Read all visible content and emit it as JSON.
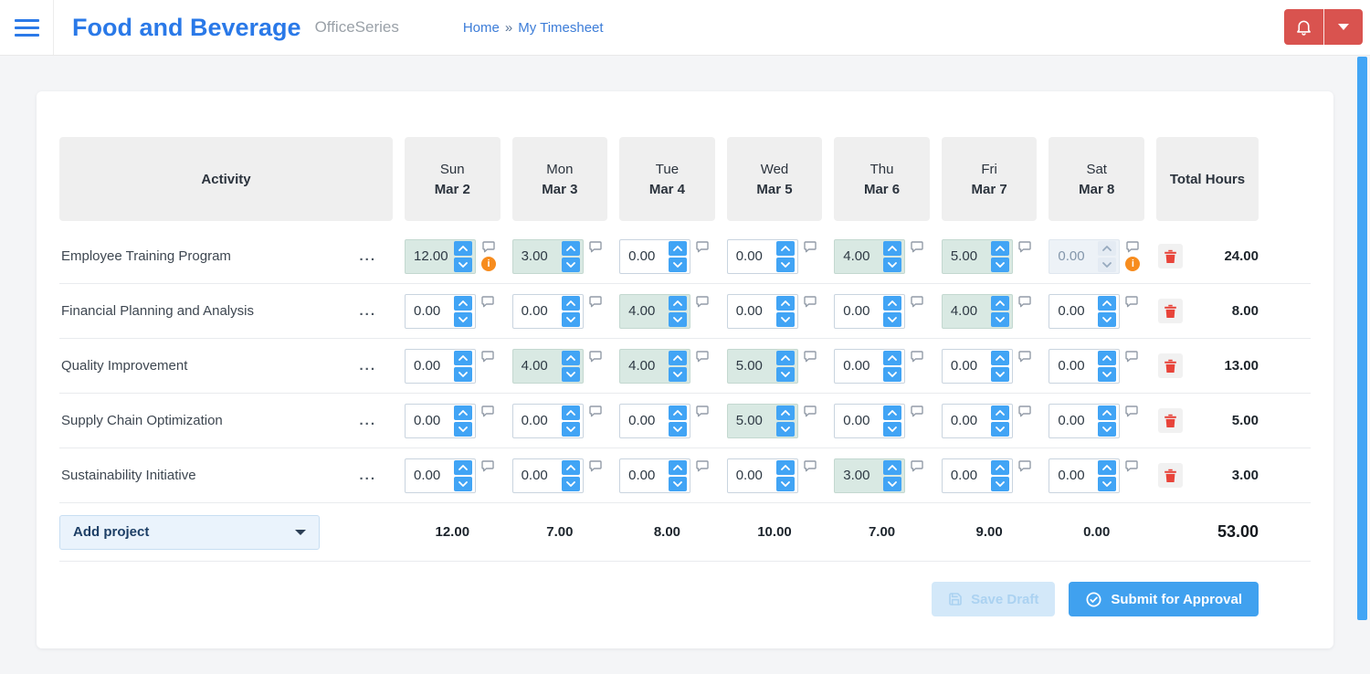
{
  "app": {
    "title": "Food and Beverage",
    "suite": "OfficeSeries",
    "breadcrumb": {
      "home": "Home",
      "separator": "»",
      "current": "My Timesheet"
    }
  },
  "icons": {
    "hamburger": "hamburger-icon",
    "bell": "bell-icon",
    "caret_down": "caret-down-icon",
    "comment": "comment-bubble-icon",
    "warning": "warning-info-icon",
    "trash": "trash-icon",
    "save": "floppy-disk-icon",
    "submit": "check-circle-icon",
    "spinner_up": "chevron-up-icon",
    "spinner_down": "chevron-down-icon"
  },
  "colors": {
    "accent_blue": "#41a4f5",
    "title_blue": "#2a79e8",
    "header_red": "#d9534f",
    "highlight_teal": "#d9e9e3",
    "warning_orange": "#f78c1e",
    "trash_red": "#e8443a",
    "header_cell_gray": "#efefef",
    "page_bg": "#f4f5f7"
  },
  "timesheet": {
    "activity_header": "Activity",
    "total_header": "Total Hours",
    "days": [
      {
        "name": "Sun",
        "date": "Mar 2"
      },
      {
        "name": "Mon",
        "date": "Mar 3"
      },
      {
        "name": "Tue",
        "date": "Mar 4"
      },
      {
        "name": "Wed",
        "date": "Mar 5"
      },
      {
        "name": "Thu",
        "date": "Mar 6"
      },
      {
        "name": "Fri",
        "date": "Mar 7"
      },
      {
        "name": "Sat",
        "date": "Mar 8"
      }
    ],
    "rows": [
      {
        "activity": "Employee Training Program",
        "values": [
          "12.00",
          "3.00",
          "0.00",
          "0.00",
          "4.00",
          "5.00",
          "0.00"
        ],
        "disabled_cols": [
          6
        ],
        "warning_cols": [
          0,
          6
        ],
        "total": "24.00"
      },
      {
        "activity": "Financial Planning and Analysis",
        "values": [
          "0.00",
          "0.00",
          "4.00",
          "0.00",
          "0.00",
          "4.00",
          "0.00"
        ],
        "disabled_cols": [],
        "warning_cols": [],
        "total": "8.00"
      },
      {
        "activity": "Quality Improvement",
        "values": [
          "0.00",
          "4.00",
          "4.00",
          "5.00",
          "0.00",
          "0.00",
          "0.00"
        ],
        "disabled_cols": [],
        "warning_cols": [],
        "total": "13.00"
      },
      {
        "activity": "Supply Chain Optimization",
        "values": [
          "0.00",
          "0.00",
          "0.00",
          "5.00",
          "0.00",
          "0.00",
          "0.00"
        ],
        "disabled_cols": [],
        "warning_cols": [],
        "total": "5.00"
      },
      {
        "activity": "Sustainability Initiative",
        "values": [
          "0.00",
          "0.00",
          "0.00",
          "0.00",
          "3.00",
          "0.00",
          "0.00"
        ],
        "disabled_cols": [],
        "warning_cols": [],
        "total": "3.00"
      }
    ],
    "row_menu_glyph": "...",
    "warning_glyph": "i",
    "add_project_label": "Add project",
    "daily_totals": [
      "12.00",
      "7.00",
      "8.00",
      "10.00",
      "7.00",
      "9.00",
      "0.00"
    ],
    "grand_total": "53.00",
    "actions": {
      "save_draft": "Save Draft",
      "submit": "Submit for Approval"
    }
  }
}
